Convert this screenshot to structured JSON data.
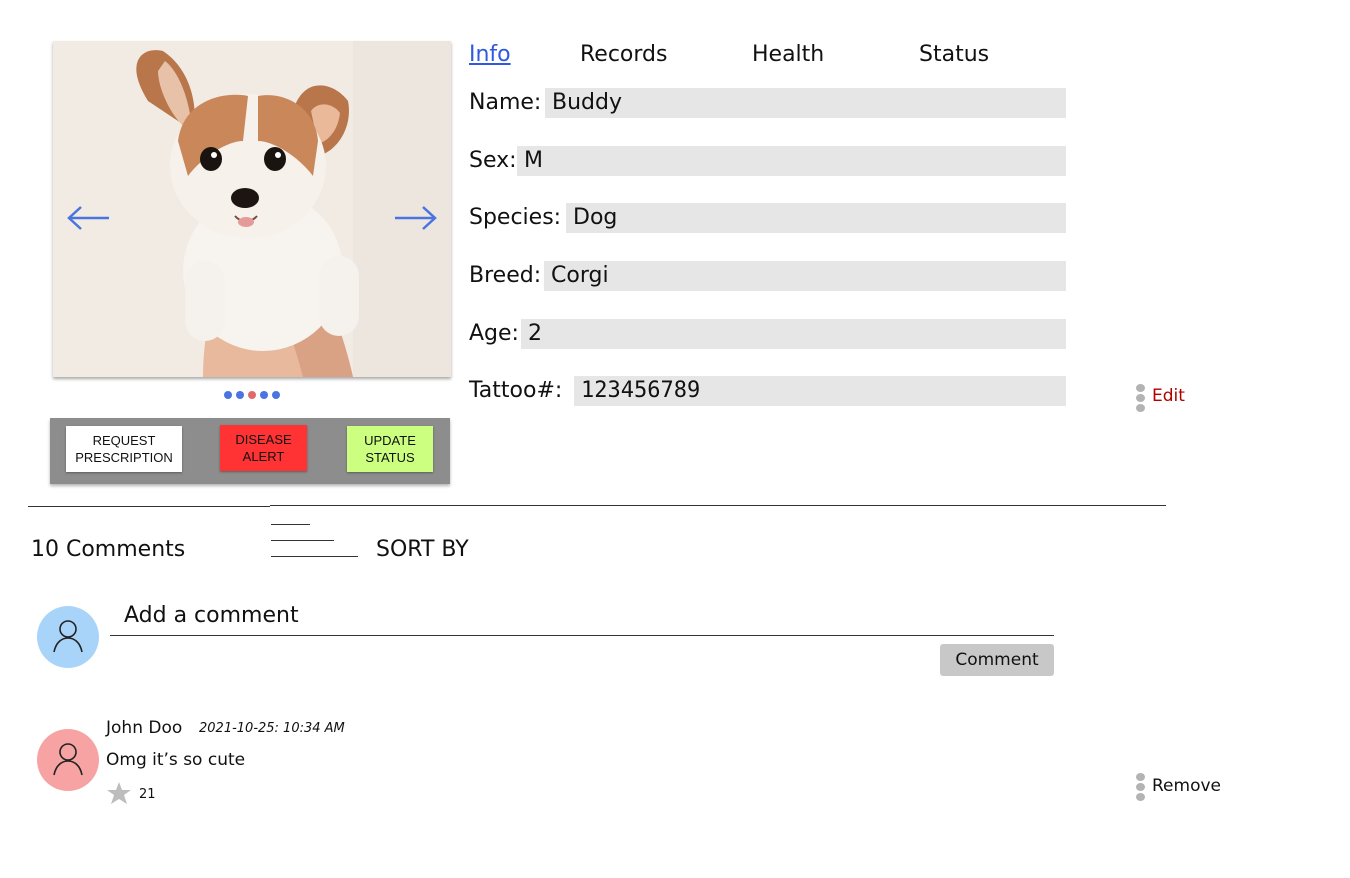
{
  "carousel": {
    "image_alt": "Corgi puppy being held up",
    "prev_icon": "arrow-left-icon",
    "next_icon": "arrow-right-icon",
    "slide_count": 5,
    "active_slide": 3
  },
  "actions": {
    "request_prescription": "REQUEST\nPRESCRIPTION",
    "disease_alert": "DISEASE\nALERT",
    "update_status": "UPDATE\nSTATUS"
  },
  "tabs": [
    {
      "label": "Info",
      "active": true
    },
    {
      "label": "Records",
      "active": false
    },
    {
      "label": "Health",
      "active": false
    },
    {
      "label": "Status",
      "active": false
    }
  ],
  "info": {
    "name_label": "Name:",
    "name_value": "Buddy",
    "sex_label": "Sex:",
    "sex_value": "M",
    "species_label": "Species:",
    "species_value": "Dog",
    "breed_label": "Breed:",
    "breed_value": "Corgi",
    "age_label": "Age:",
    "age_value": "2",
    "tattoo_label": "Tattoo#:",
    "tattoo_value": "123456789",
    "edit_label": "Edit"
  },
  "comments": {
    "count_label": "10 Comments",
    "sort_label": "SORT BY",
    "add_placeholder": "Add a comment",
    "submit_label": "Comment",
    "items": [
      {
        "author": "John Doo",
        "timestamp": "2021-10-25: 10:34 AM",
        "text": "Omg it’s so cute",
        "stars": "21",
        "remove_label": "Remove"
      }
    ]
  },
  "colors": {
    "accent_blue": "#2f59e0",
    "alert_red": "#ff3333",
    "status_green": "#ccff80",
    "edit_red": "#b00000",
    "avatar_blue": "#a9d4fa",
    "avatar_pink": "#f7a3a3"
  }
}
